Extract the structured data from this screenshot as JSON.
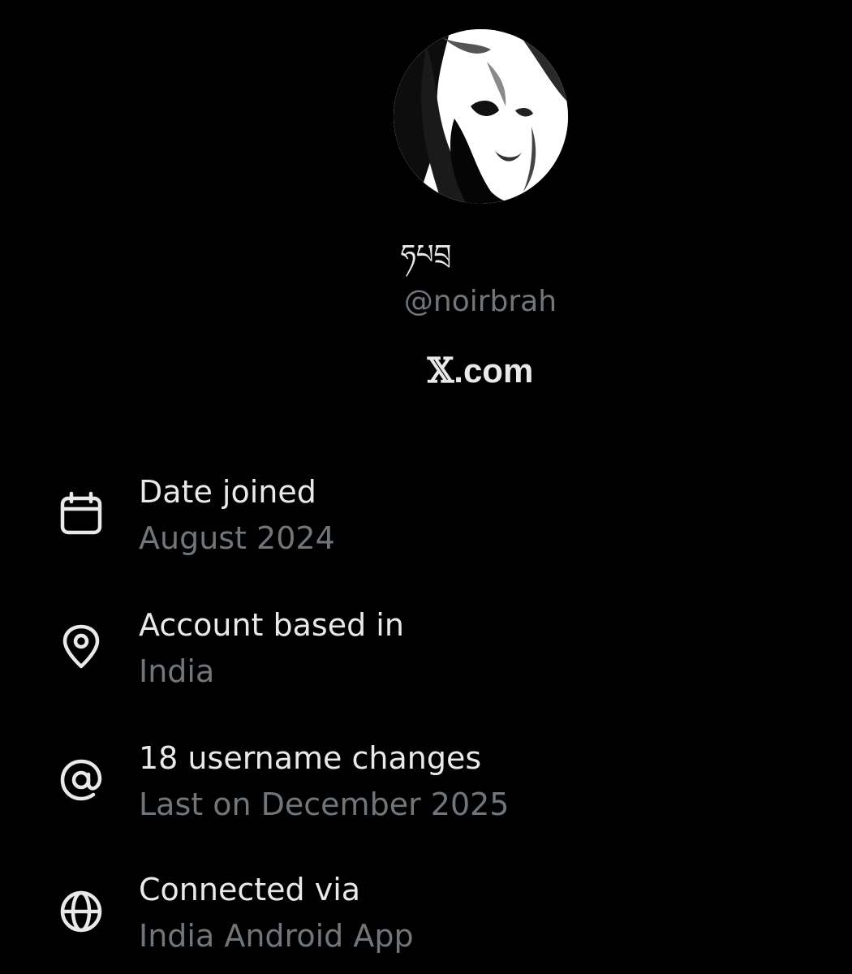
{
  "profile": {
    "display_name": "ཧཔབྲ",
    "handle": "@noirbrah",
    "brand_glyph": "𝕏",
    "brand_suffix": ".com"
  },
  "about": [
    {
      "icon": "calendar-icon",
      "title": "Date joined",
      "value": "August 2024"
    },
    {
      "icon": "location-pin-icon",
      "title": "Account based in",
      "value": "India"
    },
    {
      "icon": "at-sign-icon",
      "title": "18 username changes",
      "value": "Last on December 2025"
    },
    {
      "icon": "globe-icon",
      "title": "Connected via",
      "value": "India Android App"
    }
  ],
  "colors": {
    "background": "#000000",
    "primary_text": "#e7e9ea",
    "secondary_text": "#71767b"
  }
}
